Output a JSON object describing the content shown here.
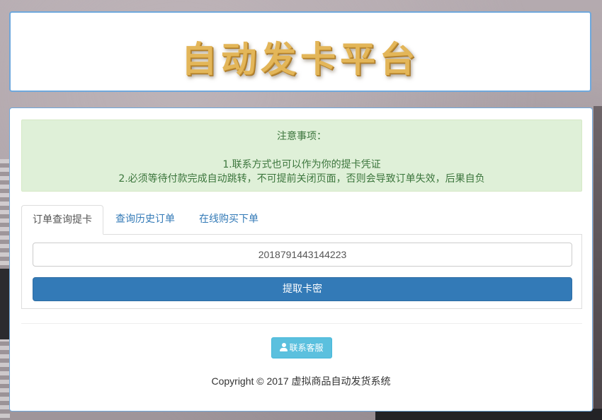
{
  "header": {
    "logo_text": "自动发卡平台"
  },
  "notice": {
    "title": "注意事项：",
    "line1": "1.联系方式也可以作为你的提卡凭证",
    "line2": "2.必须等待付款完成自动跳转，不可提前关闭页面，否则会导致订单失效，后果自负"
  },
  "tabs": [
    {
      "label": "订单查询提卡",
      "active": true
    },
    {
      "label": "查询历史订单",
      "active": false
    },
    {
      "label": "在线购买下单",
      "active": false
    }
  ],
  "query": {
    "order_value": "2018791443144223",
    "extract_button_label": "提取卡密"
  },
  "contact": {
    "button_label": "联系客服",
    "icon": "user-icon"
  },
  "footer": {
    "copyright": "Copyright © 2017 虚拟商品自动发货系统"
  },
  "colors": {
    "primary": "#337ab7",
    "info": "#5bc0de",
    "success_bg": "#dff0d8",
    "success_text": "#3c763d",
    "panel_border": "#6fa8dc",
    "logo_gold": "#e3b659"
  }
}
